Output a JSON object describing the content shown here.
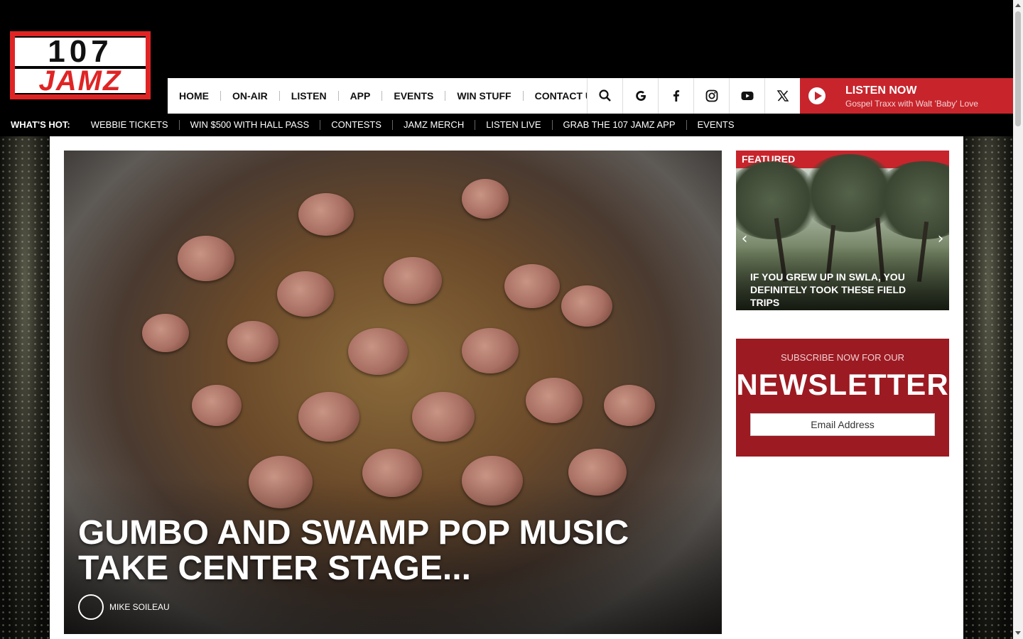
{
  "logo": {
    "top": "107",
    "bottom": "JAMZ"
  },
  "nav": {
    "items": [
      "HOME",
      "ON-AIR",
      "LISTEN",
      "APP",
      "EVENTS",
      "WIN STUFF",
      "CONTACT US"
    ]
  },
  "icons": [
    "search-icon",
    "google-icon",
    "facebook-icon",
    "instagram-icon",
    "youtube-icon",
    "x-icon"
  ],
  "listen_now": {
    "title": "LISTEN NOW",
    "subtitle": "Gospel Traxx with Walt 'Baby' Love"
  },
  "whats_hot": {
    "label": "WHAT'S HOT:",
    "items": [
      "WEBBIE TICKETS",
      "WIN $500 WITH HALL PASS",
      "CONTESTS",
      "JAMZ MERCH",
      "LISTEN LIVE",
      "GRAB THE 107 JAMZ APP",
      "EVENTS"
    ]
  },
  "hero": {
    "title": "GUMBO AND SWAMP POP MUSIC TAKE CENTER STAGE...",
    "author": "MIKE SOILEAU"
  },
  "featured": {
    "label": "FEATURED",
    "title": "IF YOU GREW UP IN SWLA, YOU DEFINITELY TOOK THESE FIELD TRIPS"
  },
  "newsletter": {
    "subtitle": "SUBSCRIBE NOW FOR OUR",
    "title": "NEWSLETTER",
    "placeholder": "Email Address"
  },
  "colors": {
    "brand_red": "#c8242c",
    "newsletter_red": "#9c1a22"
  }
}
